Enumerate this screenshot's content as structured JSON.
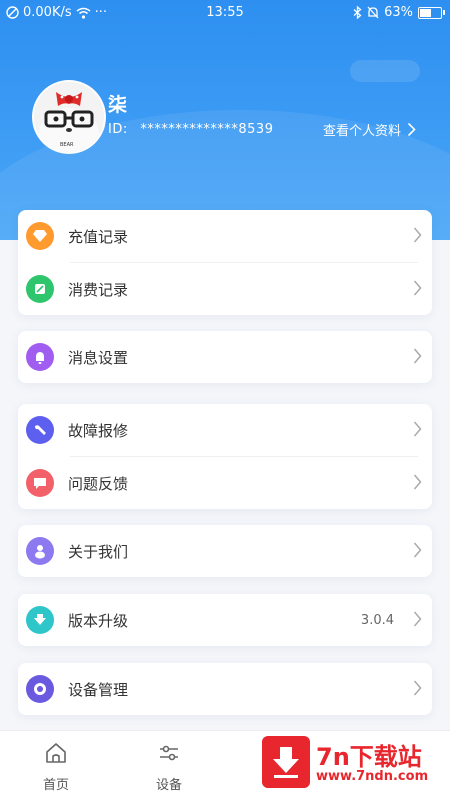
{
  "status_bar": {
    "network_speed": "0.00K/s",
    "more": "···",
    "time": "13:55",
    "battery": "63%",
    "battery_level": 0.63
  },
  "profile": {
    "name": "柒",
    "id_label": "ID:",
    "id_value": "**************8539",
    "view_profile": "查看个人资料",
    "avatar_text": "BEAR"
  },
  "menu_groups": [
    {
      "items": [
        {
          "label": "充值记录",
          "icon": "diamond-icon",
          "color": "#ff9a2e"
        },
        {
          "label": "消费记录",
          "icon": "receipt-icon",
          "color": "#2fc56c"
        }
      ]
    },
    {
      "items": [
        {
          "label": "消息设置",
          "icon": "bell-icon",
          "color": "#a15cf0"
        }
      ]
    },
    {
      "items": [
        {
          "label": "故障报修",
          "icon": "wrench-icon",
          "color": "#5d5fef"
        },
        {
          "label": "问题反馈",
          "icon": "feedback-icon",
          "color": "#f2616a"
        }
      ]
    },
    {
      "items": [
        {
          "label": "关于我们",
          "icon": "info-icon",
          "color": "#8d79f0"
        }
      ]
    },
    {
      "items": [
        {
          "label": "版本升级",
          "icon": "upgrade-icon",
          "color": "#2ec6c9",
          "value": "3.0.4"
        }
      ]
    },
    {
      "items": [
        {
          "label": "设备管理",
          "icon": "device-icon",
          "color": "#6a5ae0"
        }
      ]
    }
  ],
  "tabbar": {
    "home_label": "首页",
    "device_label": "设备"
  },
  "watermark": {
    "brand": "7n下载站",
    "url": "www.7ndn.com"
  },
  "colors": {
    "header": "#2d8ff0",
    "watermark": "#e8262d"
  }
}
